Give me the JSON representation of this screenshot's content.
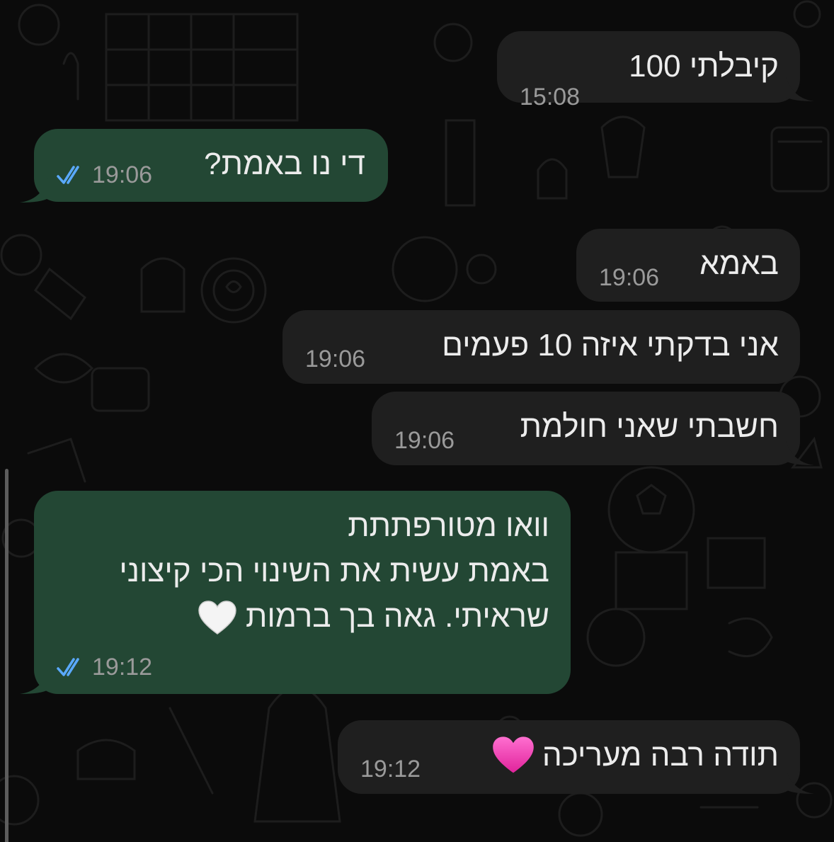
{
  "chat": {
    "messages": [
      {
        "direction": "incoming",
        "text": "קיבלתי 100",
        "time": "15:08"
      },
      {
        "direction": "outgoing",
        "text": "די נו באמת?",
        "time": "19:06",
        "status_icon": "double-check-icon"
      },
      {
        "direction": "incoming",
        "text": "באמא",
        "time": "19:06"
      },
      {
        "direction": "incoming",
        "text": "אני בדקתי איזה 10 פעמים",
        "time": "19:06"
      },
      {
        "direction": "incoming",
        "text": "חשבתי שאני חולמת",
        "time": "19:06"
      },
      {
        "direction": "outgoing",
        "line_1": "וואו מטורפתתת",
        "line_2": "באמת עשית את השינוי הכי קיצוני",
        "line_3": "שראיתי. גאה בך ברמות",
        "emoji": "white-heart",
        "time": "19:12",
        "status_icon": "double-check-icon"
      },
      {
        "direction": "incoming",
        "text": "תודה רבה מעריכה",
        "emoji": "pink-heart",
        "time": "19:12"
      }
    ]
  },
  "colors": {
    "background": "#0b0b0b",
    "incoming_bubble": "#1f1f1f",
    "outgoing_bubble": "#234734",
    "text": "#ececec",
    "timestamp": "#9a9a9a",
    "read_receipt": "#5aa9ff",
    "pattern": "#1e1e1e"
  }
}
